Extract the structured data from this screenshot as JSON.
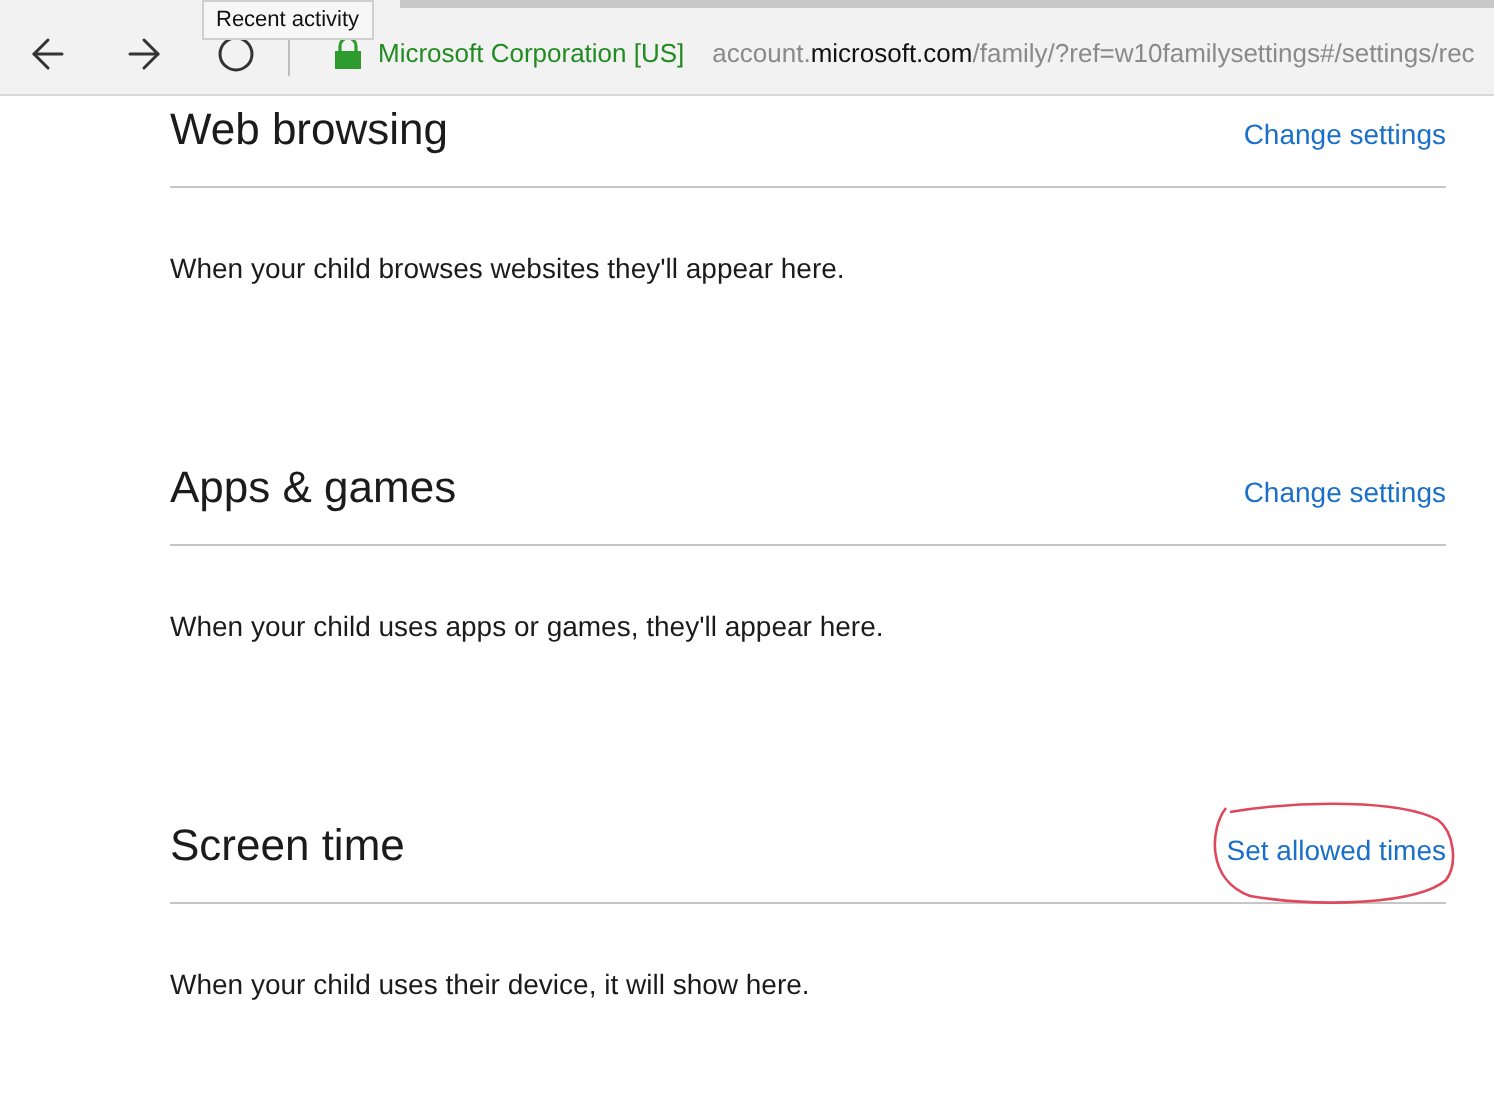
{
  "browser": {
    "tooltip": "Recent activity",
    "site_identity": "Microsoft Corporation [US]",
    "url_parts": [
      {
        "text": "account.",
        "emphasized": false
      },
      {
        "text": "microsoft.com",
        "emphasized": true
      },
      {
        "text": "/family/?ref=w10familysettings#/settings/rec",
        "emphasized": false
      }
    ]
  },
  "sections": [
    {
      "title": "Web browsing",
      "link": "Change settings",
      "description": "When your child browses websites they'll appear here.",
      "circled": false
    },
    {
      "title": "Apps & games",
      "link": "Change settings",
      "description": "When your child uses apps or games, they'll appear here.",
      "circled": false
    },
    {
      "title": "Screen time",
      "link": "Set allowed times",
      "description": "When your child uses their device, it will show here.",
      "circled": true
    }
  ]
}
